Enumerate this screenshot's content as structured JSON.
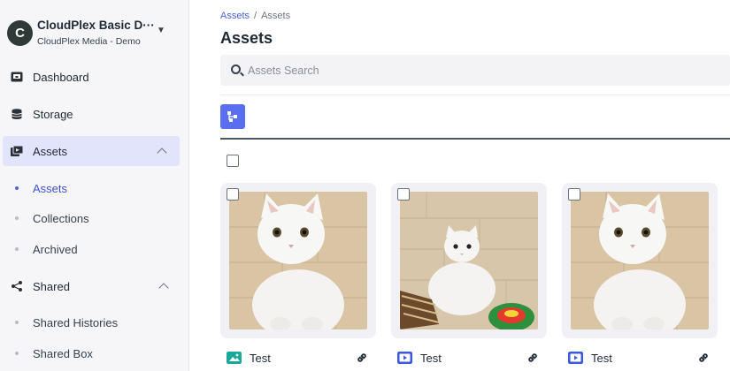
{
  "account": {
    "initial": "C",
    "name": "CloudPlex Basic D···",
    "org": "CloudPlex Media - Demo"
  },
  "nav": {
    "dashboard": "Dashboard",
    "storage": "Storage",
    "assets": "Assets",
    "assets_children": [
      "Assets",
      "Collections",
      "Archived"
    ],
    "shared": "Shared",
    "shared_children": [
      "Shared Histories",
      "Shared Box"
    ]
  },
  "breadcrumb": {
    "root": "Assets",
    "separator": "/",
    "current": "Assets"
  },
  "page_title": "Assets",
  "search": {
    "placeholder": "Assets Search",
    "value": ""
  },
  "cards": [
    {
      "name": "Test",
      "type_icon": "image-icon"
    },
    {
      "name": "Test",
      "type_icon": "video-icon"
    },
    {
      "name": "Test",
      "type_icon": "video-icon"
    }
  ],
  "colors": {
    "accent": "#5a6ff0",
    "active_nav_bg": "#e2e4fb",
    "image_type": "#1aa79c",
    "video_type": "#3b5bdb"
  }
}
